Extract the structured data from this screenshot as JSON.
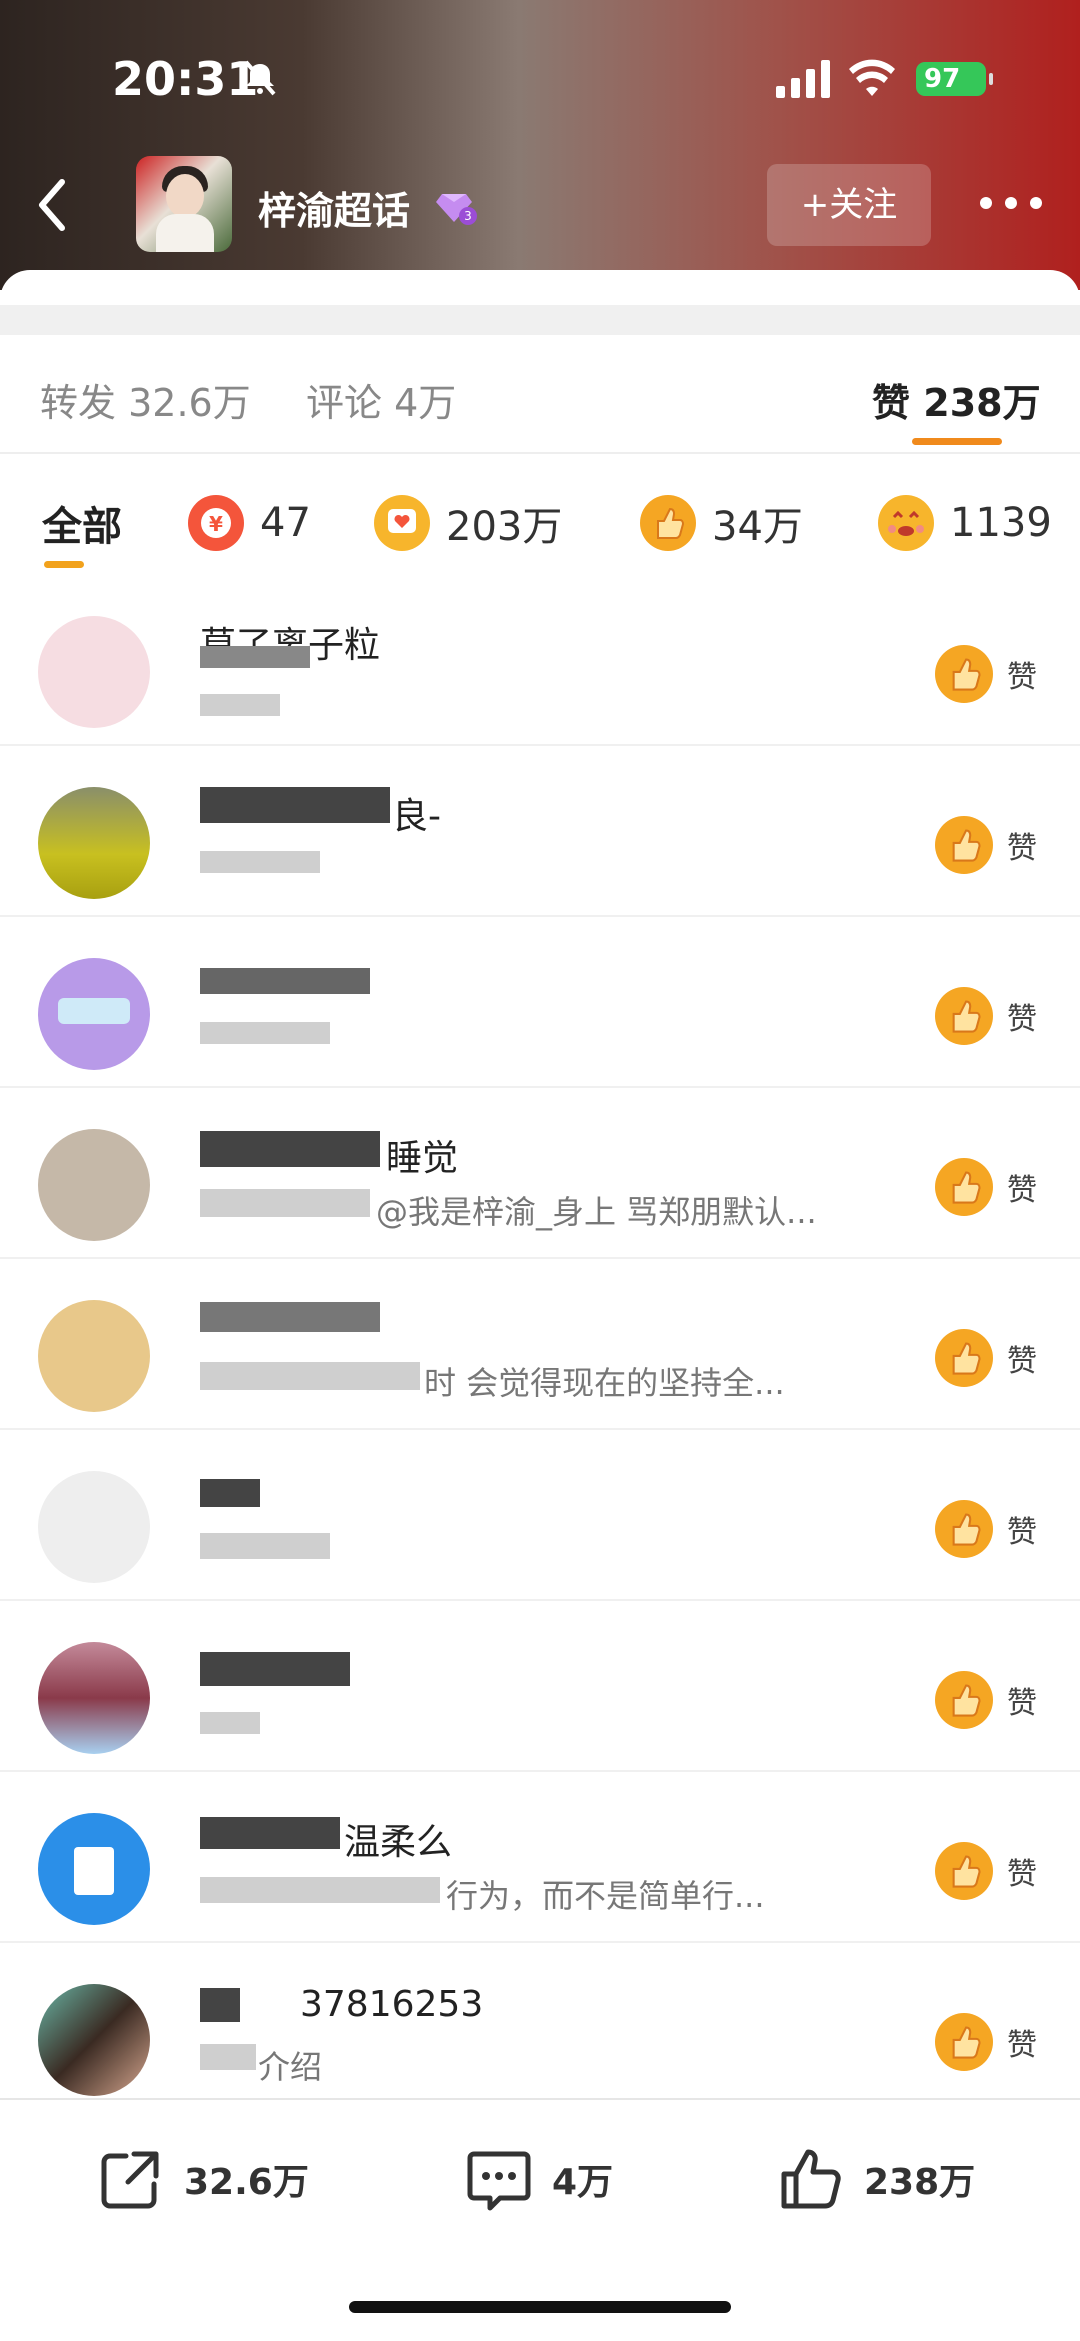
{
  "status": {
    "time": "20:31",
    "battery": "97"
  },
  "header": {
    "title": "梓渝超话",
    "follow_label": "+关注"
  },
  "tabs": {
    "repost": {
      "label": "转发",
      "count": "32.6万"
    },
    "comment": {
      "label": "评论",
      "count": "4万"
    },
    "like": {
      "label": "赞",
      "count": "238万"
    }
  },
  "filters": [
    {
      "label": "全部"
    },
    {
      "label": "47",
      "icon": "yuan-gift-icon"
    },
    {
      "label": "203万",
      "icon": "heart-bubble-icon"
    },
    {
      "label": "34万",
      "icon": "thumb-icon"
    },
    {
      "label": "1139",
      "icon": "love-face-icon"
    }
  ],
  "rows": [
    {
      "name": "莫了离子粒",
      "sub": ""
    },
    {
      "name": "良-",
      "sub": ""
    },
    {
      "name": "",
      "sub": ""
    },
    {
      "name": "睡觉",
      "sub": "@我是梓渝_身上  骂郑朋默认..."
    },
    {
      "name": "",
      "sub": "时  会觉得现在的坚持全..."
    },
    {
      "name": "",
      "sub": ""
    },
    {
      "name": "",
      "sub": ""
    },
    {
      "name": "温柔么",
      "sub": "行为，而不是简单行..."
    },
    {
      "name": "37816253",
      "sub": "介绍"
    }
  ],
  "row_like_label": "赞",
  "bottom_bar": {
    "repost": "32.6万",
    "comment": "4万",
    "like": "238万"
  },
  "colors": {
    "accent_orange": "#f08a1c",
    "like_yellow": "#f5a623",
    "battery_green": "#35c759"
  }
}
